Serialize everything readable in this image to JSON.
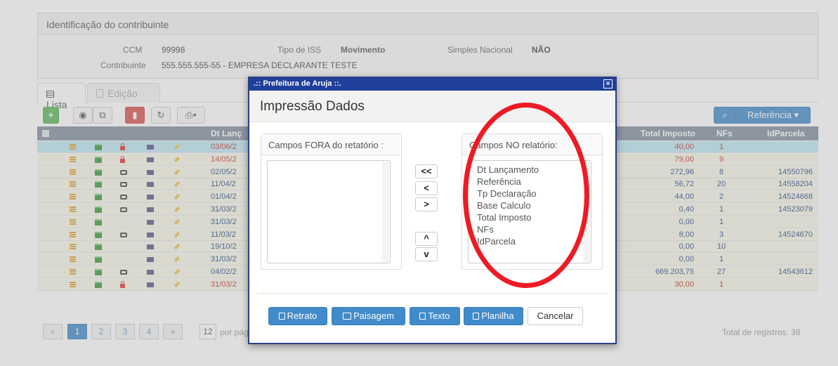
{
  "identificacao": {
    "title": "Identificação do contribuinte",
    "ccm_label": "CCM",
    "ccm_value": "99998",
    "tipo_iss_label": "Tipo de ISS",
    "tipo_iss_value": "Movimento",
    "simples_label": "Simples Nacional",
    "simples_value": "NÃO",
    "contribuinte_label": "Contribuinte",
    "contribuinte_value": "555.555.555-55 - EMPRESA DECLARANTE TESTE"
  },
  "tabs": [
    {
      "label": "Lista"
    },
    {
      "label": "Edição"
    }
  ],
  "toolbar": {
    "referencia_label": "Referência ▾",
    "search_icon": "search-icon"
  },
  "table": {
    "headers": {
      "dt": "Dt Lanç",
      "total_imposto": "Total Imposto",
      "nfs": "NFs",
      "idparcela": "IdParcela"
    },
    "rows": [
      {
        "dt": "03/06/2",
        "total": "40,00",
        "nfs": "1",
        "id": "",
        "lock": true,
        "color": "red"
      },
      {
        "dt": "14/05/2",
        "total": "79,00",
        "nfs": "9",
        "id": "",
        "lock": true,
        "color": "red"
      },
      {
        "dt": "02/05/2",
        "total": "272,96",
        "nfs": "8",
        "id": "14550796",
        "lock": false,
        "color": "blue"
      },
      {
        "dt": "11/04/2",
        "total": "56,72",
        "nfs": "20",
        "id": "14558204",
        "lock": false,
        "color": "blue"
      },
      {
        "dt": "01/04/2",
        "total": "44,00",
        "nfs": "2",
        "id": "14524668",
        "lock": false,
        "color": "blue"
      },
      {
        "dt": "31/03/2",
        "total": "0,40",
        "nfs": "1",
        "id": "14523079",
        "lock": false,
        "color": "blue"
      },
      {
        "dt": "31/03/2",
        "total": "0,00",
        "nfs": "1",
        "id": "",
        "lock": null,
        "color": "blue"
      },
      {
        "dt": "11/03/2",
        "total": "8,00",
        "nfs": "3",
        "id": "14524670",
        "lock": false,
        "color": "blue"
      },
      {
        "dt": "19/10/2",
        "total": "0,00",
        "nfs": "10",
        "id": "",
        "lock": null,
        "color": "blue"
      },
      {
        "dt": "31/03/2",
        "total": "0,00",
        "nfs": "1",
        "id": "",
        "lock": null,
        "color": "blue"
      },
      {
        "dt": "04/02/2",
        "total": "669.203,75",
        "nfs": "27",
        "id": "14543612",
        "lock": false,
        "color": "blue"
      },
      {
        "dt": "31/03/2",
        "total": "30,00",
        "nfs": "1",
        "id": "",
        "lock": true,
        "color": "red"
      }
    ]
  },
  "pagination": {
    "prev": "«",
    "pages": [
      "1",
      "2",
      "3",
      "4"
    ],
    "next": "»",
    "per_page": "12",
    "per_page_label": "por página",
    "total": "Total de registros: 38"
  },
  "modal": {
    "window_title": ".:: Prefeitura de Aruja ::.",
    "close": "×",
    "heading": "Impressão Dados",
    "left_title": "Campos FORA do retatório :",
    "right_title": "Campos NO relatório:",
    "right_items": [
      "Dt Lançamento",
      "Referência",
      "Tp Declaração",
      "Base Calculo",
      "Total Imposto",
      "NFs",
      "IdParcela"
    ],
    "move_all_left": "<<",
    "move_left": "<",
    "move_right": ">",
    "move_up": "^",
    "move_down": "v",
    "buttons": {
      "retrato": "Retrato",
      "paisagem": "Paisagem",
      "texto": "Texto",
      "planilha": "Planilha",
      "cancelar": "Cancelar"
    }
  },
  "colors": {
    "modal_bar": "#1e3f9c",
    "primary": "#428bca",
    "annotation": "#ee1b24"
  }
}
